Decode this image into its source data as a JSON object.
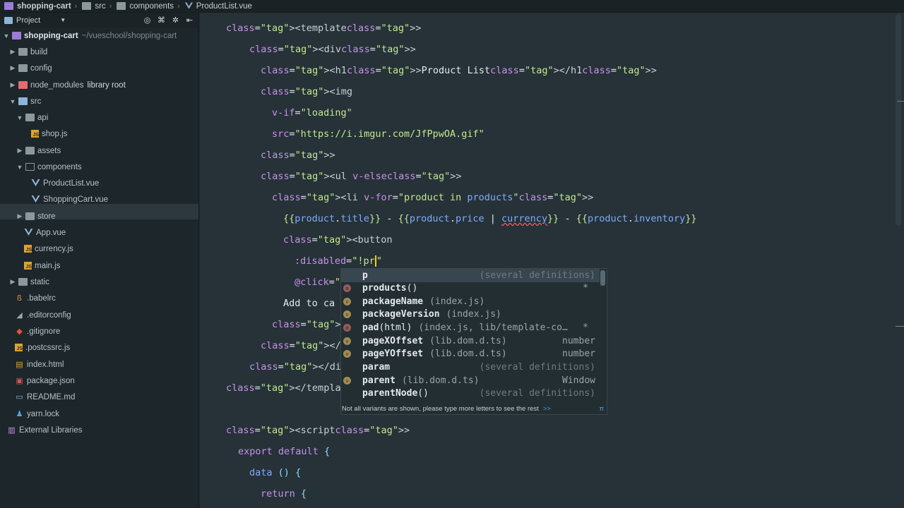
{
  "breadcrumb": {
    "items": [
      "shopping-cart",
      "src",
      "components",
      "ProductList.vue"
    ]
  },
  "project_panel": {
    "title": "Project",
    "tools": [
      "target-icon",
      "collapse-icon",
      "gear-icon",
      "hide-icon"
    ],
    "root": {
      "name": "shopping-cart",
      "path": "~/vueschool/shopping-cart"
    },
    "tree": [
      {
        "label": "build",
        "extra": ""
      },
      {
        "label": "config",
        "extra": ""
      },
      {
        "label": "node_modules",
        "extra": "library root"
      },
      {
        "label": "src",
        "extra": ""
      },
      {
        "label": "api",
        "extra": ""
      },
      {
        "label": "shop.js",
        "extra": ""
      },
      {
        "label": "assets",
        "extra": ""
      },
      {
        "label": "components",
        "extra": ""
      },
      {
        "label": "ProductList.vue",
        "extra": ""
      },
      {
        "label": "ShoppingCart.vue",
        "extra": ""
      },
      {
        "label": "store",
        "extra": ""
      },
      {
        "label": "App.vue",
        "extra": ""
      },
      {
        "label": "currency.js",
        "extra": ""
      },
      {
        "label": "main.js",
        "extra": ""
      },
      {
        "label": "static",
        "extra": ""
      },
      {
        "label": ".babelrc",
        "extra": ""
      },
      {
        "label": ".editorconfig",
        "extra": ""
      },
      {
        "label": ".gitignore",
        "extra": ""
      },
      {
        "label": ".postcssrc.js",
        "extra": ""
      },
      {
        "label": "index.html",
        "extra": ""
      },
      {
        "label": "package.json",
        "extra": ""
      },
      {
        "label": "README.md",
        "extra": ""
      },
      {
        "label": "yarn.lock",
        "extra": ""
      },
      {
        "label": "External Libraries",
        "extra": ""
      }
    ]
  },
  "editor": {
    "lines": [
      "<template>",
      "<div>",
      "<h1>Product List</h1>",
      "<img",
      "v-if=\"loading\"",
      "src=\"https://i.imgur.com/JfPpwOA.gif\"",
      ">",
      "<ul v-else>",
      "<li v-for=\"product in products\">",
      "{{product.title}} - {{product.price | currency}} - {{product.inventory}}",
      "<button",
      ":disabled=\"!pr\"",
      "@click=\"",
      "Add to ca",
      "</li>",
      "</ul>",
      "</div>",
      "</template>",
      "",
      "<script>",
      "export default {",
      "data () {",
      "return {"
    ]
  },
  "completion": {
    "items": [
      {
        "name": "p",
        "rest": "",
        "loc": "",
        "type": "(several definitions)",
        "icon": "none",
        "selected": true
      },
      {
        "name": "products",
        "rest": "()",
        "loc": "",
        "type": "*",
        "icon": "method"
      },
      {
        "name": "packageName",
        "rest": "",
        "loc": "(index.js)",
        "type": "",
        "icon": "variable"
      },
      {
        "name": "packageVersion",
        "rest": "",
        "loc": "(index.js)",
        "type": "",
        "icon": "variable"
      },
      {
        "name": "pad",
        "rest": "(html)",
        "loc": "(index.js, lib/template-co…",
        "type": "*",
        "icon": "method"
      },
      {
        "name": "pageXOffset",
        "rest": "",
        "loc": "(lib.dom.d.ts)",
        "type": "number",
        "icon": "variable"
      },
      {
        "name": "pageYOffset",
        "rest": "",
        "loc": "(lib.dom.d.ts)",
        "type": "number",
        "icon": "variable"
      },
      {
        "name": "param",
        "rest": "",
        "loc": "",
        "type": "(several definitions)",
        "icon": "none"
      },
      {
        "name": "parent",
        "rest": "",
        "loc": "(lib.dom.d.ts)",
        "type": "Window",
        "icon": "variable"
      },
      {
        "name": "parentNode",
        "rest": "()",
        "loc": "",
        "type": "(several definitions)",
        "icon": "none"
      }
    ],
    "footer": "Not all variants are shown, please type more letters to see the rest",
    "footer_link": ">>",
    "footer_pi": "π"
  }
}
